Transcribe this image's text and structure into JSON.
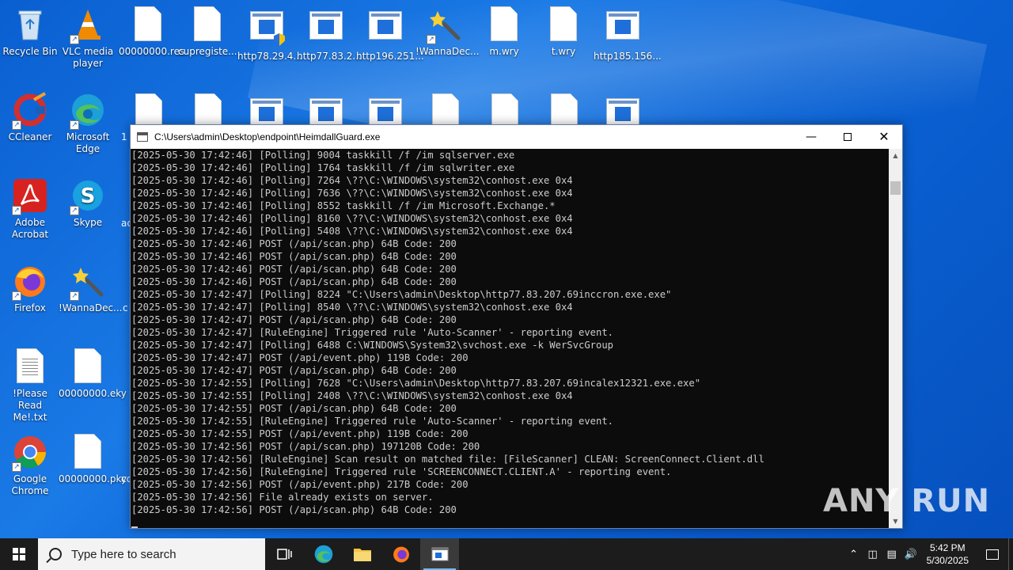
{
  "desktop": {
    "icons": [
      {
        "label": "Recycle Bin"
      },
      {
        "label": "VLC media player"
      },
      {
        "label": "00000000.res"
      },
      {
        "label": "cupregiste..."
      },
      {
        "label": "http78.29.4..."
      },
      {
        "label": "http77.83.2..."
      },
      {
        "label": "http196.251..."
      },
      {
        "label": "!WannaDec..."
      },
      {
        "label": "m.wry"
      },
      {
        "label": "t.wry"
      },
      {
        "label": "http185.156..."
      },
      {
        "label": "CCleaner"
      },
      {
        "label": "Microsoft Edge"
      },
      {
        "label": "Adobe Acrobat"
      },
      {
        "label": "Skype"
      },
      {
        "label": "Firefox"
      },
      {
        "label": "!WannaDec..."
      },
      {
        "label": "!Please Read Me!.txt"
      },
      {
        "label": "00000000.eky"
      },
      {
        "label": "Google Chrome"
      },
      {
        "label": "00000000.pky"
      }
    ],
    "partial_labels": [
      "1",
      "ac",
      "c",
      "cc"
    ]
  },
  "window": {
    "title": "C:\\Users\\admin\\Desktop\\endpoint\\HeimdallGuard.exe",
    "lines": [
      "[2025-05-30 17:42:46] [Polling] 9004 taskkill /f /im sqlserver.exe",
      "[2025-05-30 17:42:46] [Polling] 1764 taskkill /f /im sqlwriter.exe",
      "[2025-05-30 17:42:46] [Polling] 7264 \\??\\C:\\WINDOWS\\system32\\conhost.exe 0x4",
      "[2025-05-30 17:42:46] [Polling] 7636 \\??\\C:\\WINDOWS\\system32\\conhost.exe 0x4",
      "[2025-05-30 17:42:46] [Polling] 8552 taskkill /f /im Microsoft.Exchange.*",
      "[2025-05-30 17:42:46] [Polling] 8160 \\??\\C:\\WINDOWS\\system32\\conhost.exe 0x4",
      "[2025-05-30 17:42:46] [Polling] 5408 \\??\\C:\\WINDOWS\\system32\\conhost.exe 0x4",
      "[2025-05-30 17:42:46] POST (/api/scan.php) 64B Code: 200",
      "[2025-05-30 17:42:46] POST (/api/scan.php) 64B Code: 200",
      "[2025-05-30 17:42:46] POST (/api/scan.php) 64B Code: 200",
      "[2025-05-30 17:42:46] POST (/api/scan.php) 64B Code: 200",
      "[2025-05-30 17:42:47] [Polling] 8224 \"C:\\Users\\admin\\Desktop\\http77.83.207.69inccron.exe.exe\"",
      "[2025-05-30 17:42:47] [Polling] 8540 \\??\\C:\\WINDOWS\\system32\\conhost.exe 0x4",
      "[2025-05-30 17:42:47] POST (/api/scan.php) 64B Code: 200",
      "[2025-05-30 17:42:47] [RuleEngine] Triggered rule 'Auto-Scanner' - reporting event.",
      "[2025-05-30 17:42:47] [Polling] 6488 C:\\WINDOWS\\System32\\svchost.exe -k WerSvcGroup",
      "[2025-05-30 17:42:47] POST (/api/event.php) 119B Code: 200",
      "[2025-05-30 17:42:47] POST (/api/scan.php) 64B Code: 200",
      "[2025-05-30 17:42:55] [Polling] 7628 \"C:\\Users\\admin\\Desktop\\http77.83.207.69incalex12321.exe.exe\"",
      "[2025-05-30 17:42:55] [Polling] 2408 \\??\\C:\\WINDOWS\\system32\\conhost.exe 0x4",
      "[2025-05-30 17:42:55] POST (/api/scan.php) 64B Code: 200",
      "[2025-05-30 17:42:55] [RuleEngine] Triggered rule 'Auto-Scanner' - reporting event.",
      "[2025-05-30 17:42:55] POST (/api/event.php) 119B Code: 200",
      "[2025-05-30 17:42:56] POST (/api/scan.php) 197120B Code: 200",
      "[2025-05-30 17:42:56] [RuleEngine] Scan result on matched file: [FileScanner] CLEAN: ScreenConnect.Client.dll",
      "[2025-05-30 17:42:56] [RuleEngine] Triggered rule 'SCREENCONNECT.CLIENT.A' - reporting event.",
      "[2025-05-30 17:42:56] POST (/api/event.php) 217B Code: 200",
      "[2025-05-30 17:42:56] File already exists on server.",
      "[2025-05-30 17:42:56] POST (/api/scan.php) 64B Code: 200"
    ]
  },
  "watermark": "ANY RUN",
  "taskbar": {
    "search_placeholder": "Type here to search",
    "time": "5:42 PM",
    "date": "5/30/2025"
  }
}
